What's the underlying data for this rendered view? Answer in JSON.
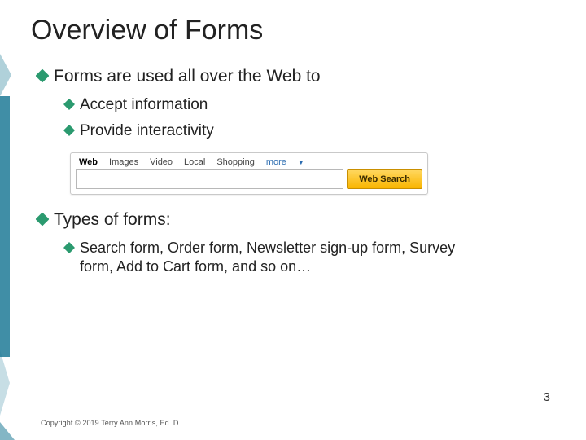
{
  "slide": {
    "title": "Overview of Forms",
    "page_number": "3",
    "copyright": "Copyright © 2019 Terry Ann Morris, Ed. D."
  },
  "bullets": {
    "b1": "Forms are used all over the Web to",
    "b1a": "Accept information",
    "b1b": "Provide interactivity",
    "b2": "Types of forms:",
    "b2a": "Search form, Order form, Newsletter sign-up form, Survey form,  Add to Cart form, and so on…"
  },
  "search_widget": {
    "tabs": {
      "web": "Web",
      "images": "Images",
      "video": "Video",
      "local": "Local",
      "shopping": "Shopping",
      "more": "more"
    },
    "button_label": "Web Search"
  }
}
